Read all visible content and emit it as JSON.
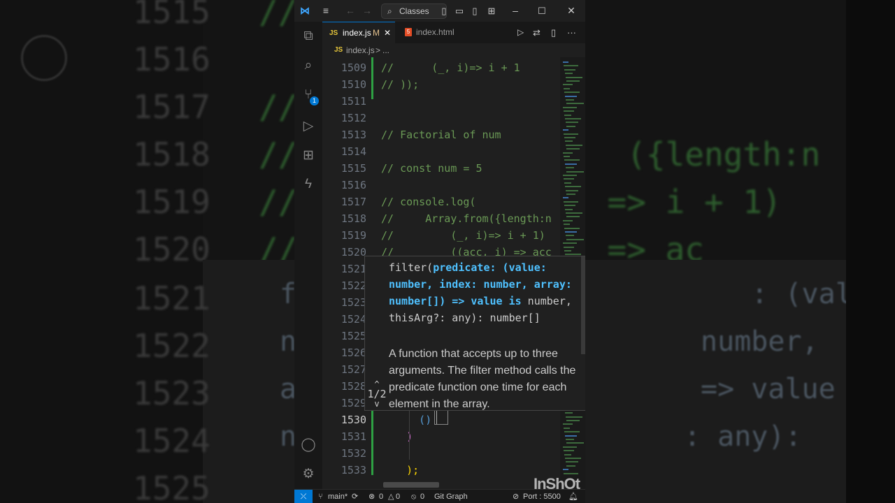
{
  "background": {
    "line_numbers": [
      "1515",
      "1516",
      "1517",
      "1518",
      "1519",
      "1520",
      "1521",
      "1522",
      "1523",
      "1524",
      "1525"
    ],
    "code_fragments": [
      {
        "text": "//"
      },
      {
        "text": "//"
      },
      {
        "text": "//"
      },
      {
        "text": "//                 ({length:n"
      },
      {
        "text": "//                => i + 1)"
      },
      {
        "text": "//             i) => ac"
      }
    ],
    "popup_fragments": [
      {
        "text": "f                           : (value:"
      },
      {
        "text": "n                        number,"
      },
      {
        "text": "a                        => value is"
      },
      {
        "text": "n                       : any):"
      }
    ]
  },
  "titlebar": {
    "search_label": "Classes",
    "app_icon": "vscode-logo-icon",
    "accent": "#0078d4"
  },
  "activity_bar": {
    "items": [
      {
        "name": "explorer-icon",
        "glyph": "⧉"
      },
      {
        "name": "search-icon",
        "glyph": "⌕"
      },
      {
        "name": "source-control-icon",
        "glyph": "⑂"
      },
      {
        "name": "run-debug-icon",
        "glyph": "▷"
      },
      {
        "name": "extensions-icon",
        "glyph": "⊞"
      },
      {
        "name": "live-share-icon",
        "glyph": "ϟ"
      }
    ],
    "scm_badge": "1",
    "bottom": [
      {
        "name": "account-icon",
        "glyph": "◯"
      },
      {
        "name": "settings-gear-icon",
        "glyph": "⚙"
      }
    ]
  },
  "tabs": [
    {
      "label": "index.js",
      "badge": "M",
      "lang": "JS",
      "active": true
    },
    {
      "label": "index.html",
      "lang": "5",
      "active": false
    }
  ],
  "breadcrumb": {
    "file": "index.js",
    "separator": ">",
    "rest": "..."
  },
  "editor": {
    "lines": [
      {
        "num": "1509",
        "code": "//      (_, i)=> i + 1",
        "color": "#6a9955"
      },
      {
        "num": "1510",
        "code": "// ));",
        "color": "#6a9955"
      },
      {
        "num": "1511",
        "code": "",
        "color": "#6a9955"
      },
      {
        "num": "1512",
        "code": "",
        "color": "#6a9955"
      },
      {
        "num": "1513",
        "code": "// Factorial of num",
        "color": "#6a9955"
      },
      {
        "num": "1514",
        "code": "",
        "color": "#6a9955"
      },
      {
        "num": "1515",
        "code": "// const num = 5",
        "color": "#6a9955"
      },
      {
        "num": "1516",
        "code": "",
        "color": "#6a9955"
      },
      {
        "num": "1517",
        "code": "// console.log(",
        "color": "#6a9955"
      },
      {
        "num": "1518",
        "code": "//     Array.from({length:n",
        "color": "#6a9955"
      },
      {
        "num": "1519",
        "code": "//         (_, i)=> i + 1)",
        "color": "#6a9955"
      },
      {
        "num": "1520",
        "code": "//         ((acc, i) => acc",
        "color": "#6a9955"
      },
      {
        "num": "1521",
        "code": "",
        "color": "#6a9955"
      },
      {
        "num": "1522",
        "code": "",
        "color": "#6a9955"
      },
      {
        "num": "1523",
        "code": "",
        "color": "#6a9955"
      },
      {
        "num": "1524",
        "code": "",
        "color": "#6a9955"
      },
      {
        "num": "1525",
        "code": "",
        "color": "#6a9955"
      },
      {
        "num": "1526",
        "code": "",
        "color": "#6a9955"
      },
      {
        "num": "1527",
        "code": "",
        "color": "#6a9955"
      },
      {
        "num": "1528",
        "code": "",
        "color": "#6a9955"
      },
      {
        "num": "1529",
        "code": "",
        "color": "#6a9955"
      },
      {
        "num": "1530",
        "code": "      ()",
        "color": "#569cd6",
        "active": true
      },
      {
        "num": "1531",
        "code": "    )",
        "color": "#da70d6"
      },
      {
        "num": "1532",
        "code": "",
        "color": "#cccccc"
      },
      {
        "num": "1533",
        "code": "    );",
        "color": "#ffd700"
      }
    ]
  },
  "hover": {
    "signature_fn": "filter(",
    "signature_param": "predicate: (value: number, index: number, array: number[]) => value is",
    "signature_rest": " number, thisArg?: any): number[]",
    "doc": "A function that accepts up to three arguments. The filter method calls the predicate function one time for each element in the array.",
    "pager": "1/2"
  },
  "statusbar": {
    "branch": "main*",
    "errors": "0",
    "warnings": "0",
    "ports": "0",
    "git_graph": "Git Graph",
    "port_label": "Port : 5500"
  },
  "watermark": "InShOt"
}
